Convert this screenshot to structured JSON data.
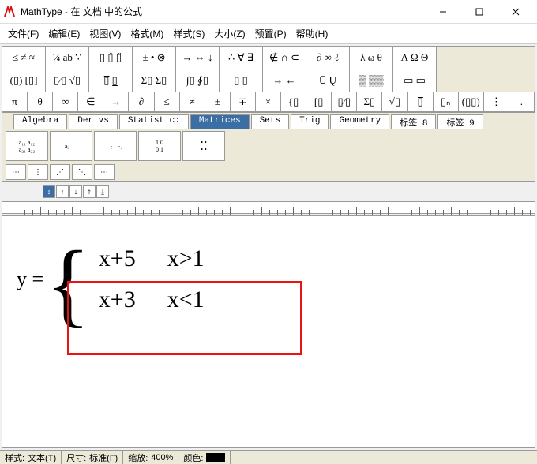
{
  "title": "MathType - 在 文档 中的公式",
  "menus": [
    "文件(F)",
    "编辑(E)",
    "视图(V)",
    "格式(M)",
    "样式(S)",
    "大小(Z)",
    "预置(P)",
    "帮助(H)"
  ],
  "toolrow1": [
    "≤ ≠ ≈",
    "¼ ab ∵",
    "▯ ▯̂ ▯̃",
    "± • ⊗",
    "→ ⇔ ↓",
    "∴ ∀ ∃",
    "∉ ∩ ⊂",
    "∂ ∞ ℓ",
    "λ ω θ",
    "Λ Ω Θ"
  ],
  "toolrow2": [
    "(▯) [▯]",
    "▯⁄▯ √▯",
    "▯̅  ▯̲",
    "Σ▯ Σ▯",
    "∫▯ ∮▯",
    "▯ ▯",
    "→ ←",
    "Ū Ų",
    "▒ ▒▒",
    "▭ ▭"
  ],
  "toolrow3": [
    "π",
    "θ",
    "∞",
    "∈",
    "→",
    "∂",
    "≤",
    "≠",
    "±",
    "∓",
    "×",
    "{▯",
    "[▯",
    "▯⁄▯",
    "Σ▯",
    "√▯",
    "▯̅",
    "▯ₙ",
    "(▯▯)",
    "⋮",
    "."
  ],
  "tabs": [
    "Algebra",
    "Derivs",
    "Statistic:",
    "Matrices",
    "Sets",
    "Trig",
    "Geometry",
    "标签 8",
    "标签 9"
  ],
  "active_tab": 3,
  "smallboxes": [
    "⋯",
    "⋮",
    "⋰",
    "⋱",
    "⋯"
  ],
  "formula": {
    "lhs": "y =",
    "cases": [
      {
        "expr": "x+5",
        "cond": "x>1"
      },
      {
        "expr": "x+3",
        "cond": "x<1"
      }
    ]
  },
  "status": {
    "style_label": "样式:",
    "style_value": "文本(T)",
    "size_label": "尺寸:",
    "size_value": "标准(F)",
    "zoom_label": "缩放:",
    "zoom_value": "400%",
    "color_label": "颜色:"
  }
}
